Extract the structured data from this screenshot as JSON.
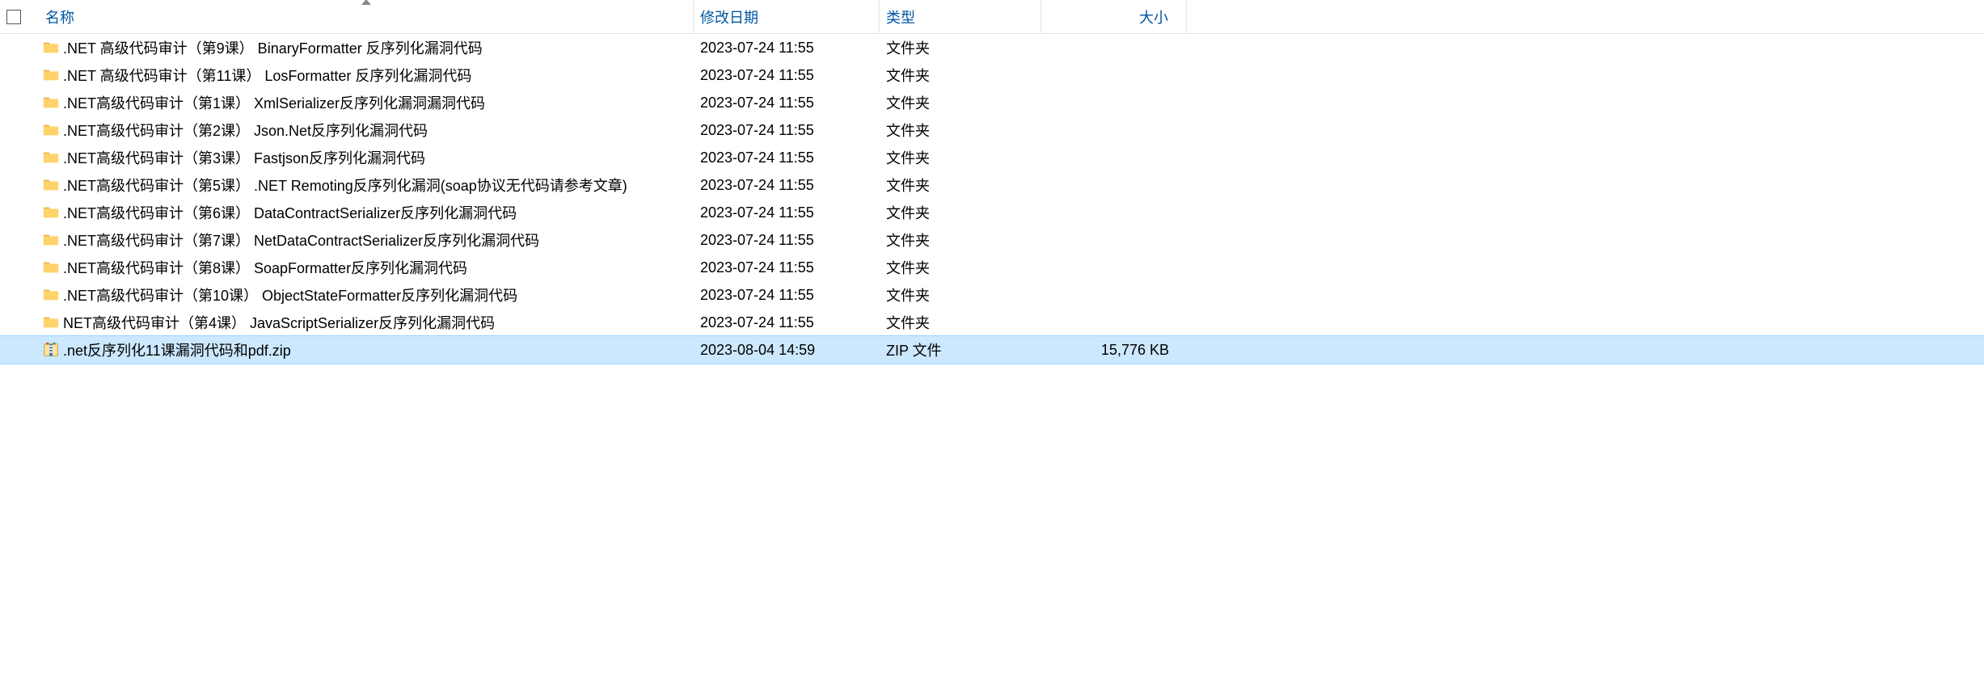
{
  "headers": {
    "name": "名称",
    "date": "修改日期",
    "type": "类型",
    "size": "大小"
  },
  "sorted_column": "name",
  "items": [
    {
      "icon": "folder",
      "name": ".NET 高级代码审计（第9课） BinaryFormatter 反序列化漏洞代码",
      "date": "2023-07-24 11:55",
      "type": "文件夹",
      "size": "",
      "selected": false
    },
    {
      "icon": "folder",
      "name": ".NET 高级代码审计（第11课） LosFormatter 反序列化漏洞代码",
      "date": "2023-07-24 11:55",
      "type": "文件夹",
      "size": "",
      "selected": false
    },
    {
      "icon": "folder",
      "name": ".NET高级代码审计（第1课） XmlSerializer反序列化漏洞漏洞代码",
      "date": "2023-07-24 11:55",
      "type": "文件夹",
      "size": "",
      "selected": false
    },
    {
      "icon": "folder",
      "name": ".NET高级代码审计（第2课） Json.Net反序列化漏洞代码",
      "date": "2023-07-24 11:55",
      "type": "文件夹",
      "size": "",
      "selected": false
    },
    {
      "icon": "folder",
      "name": ".NET高级代码审计（第3课） Fastjson反序列化漏洞代码",
      "date": "2023-07-24 11:55",
      "type": "文件夹",
      "size": "",
      "selected": false
    },
    {
      "icon": "folder",
      "name": ".NET高级代码审计（第5课） .NET Remoting反序列化漏洞(soap协议无代码请参考文章)",
      "date": "2023-07-24 11:55",
      "type": "文件夹",
      "size": "",
      "selected": false
    },
    {
      "icon": "folder",
      "name": ".NET高级代码审计（第6课） DataContractSerializer反序列化漏洞代码",
      "date": "2023-07-24 11:55",
      "type": "文件夹",
      "size": "",
      "selected": false
    },
    {
      "icon": "folder",
      "name": ".NET高级代码审计（第7课） NetDataContractSerializer反序列化漏洞代码",
      "date": "2023-07-24 11:55",
      "type": "文件夹",
      "size": "",
      "selected": false
    },
    {
      "icon": "folder",
      "name": ".NET高级代码审计（第8课） SoapFormatter反序列化漏洞代码",
      "date": "2023-07-24 11:55",
      "type": "文件夹",
      "size": "",
      "selected": false
    },
    {
      "icon": "folder",
      "name": ".NET高级代码审计（第10课） ObjectStateFormatter反序列化漏洞代码",
      "date": "2023-07-24 11:55",
      "type": "文件夹",
      "size": "",
      "selected": false
    },
    {
      "icon": "folder",
      "name": "NET高级代码审计（第4课） JavaScriptSerializer反序列化漏洞代码",
      "date": "2023-07-24 11:55",
      "type": "文件夹",
      "size": "",
      "selected": false
    },
    {
      "icon": "zip",
      "name": ".net反序列化11课漏洞代码和pdf.zip",
      "date": "2023-08-04 14:59",
      "type": "ZIP 文件",
      "size": "15,776 KB",
      "selected": true
    }
  ]
}
